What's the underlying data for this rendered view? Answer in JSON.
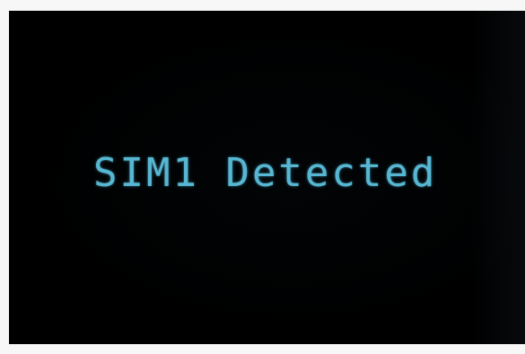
{
  "display": {
    "message": "SIM1 Detected",
    "text_color": "#57b7d3",
    "background_color": "#000000"
  }
}
